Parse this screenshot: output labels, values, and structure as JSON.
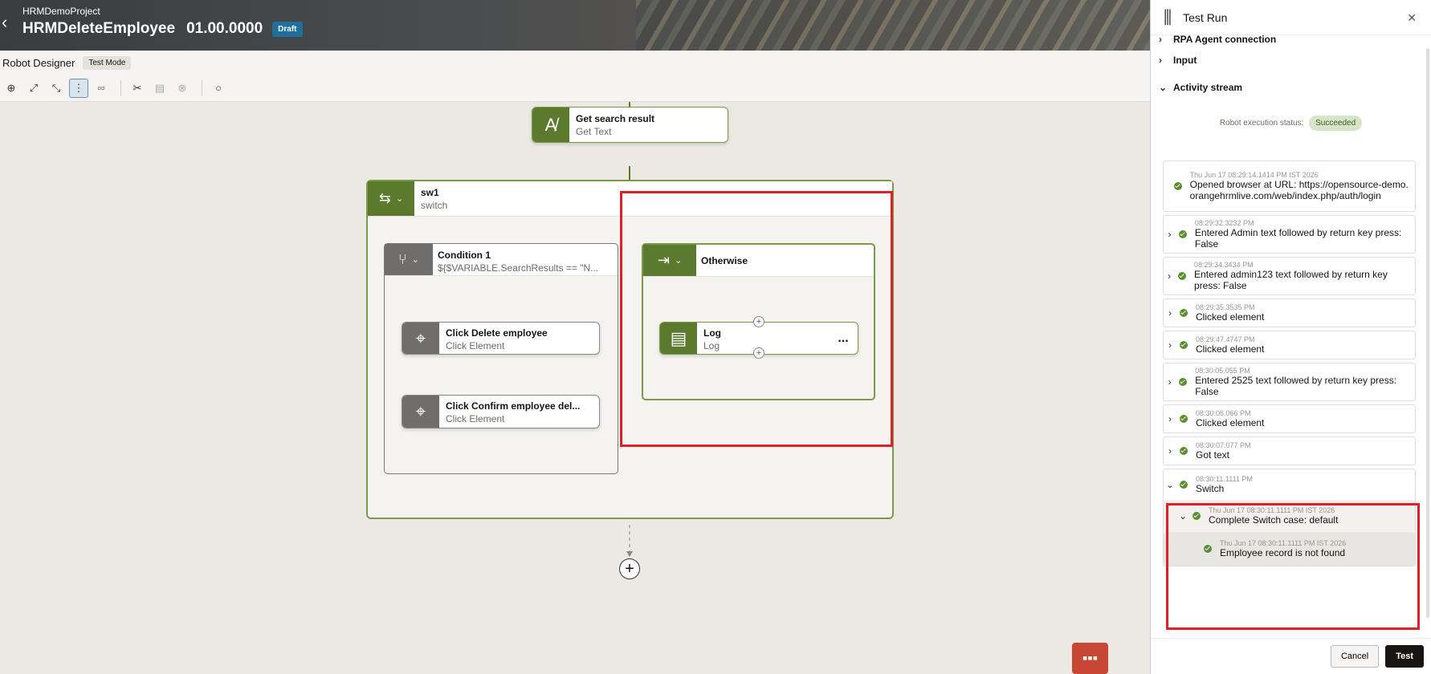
{
  "header": {
    "project": "HRMDemoProject",
    "robot_name": "HRMDeleteEmployee",
    "version": "01.00.0000",
    "status_badge": "Draft"
  },
  "subbar": {
    "title": "Robot Designer",
    "mode": "Test Mode"
  },
  "toolbar": {
    "icons": [
      "zoom-in-icon",
      "expand-icon",
      "collapse-icon",
      "vertical-layout-icon",
      "horizontal-layout-icon",
      "cut-icon",
      "paste-icon",
      "delete-icon",
      "circle-icon"
    ]
  },
  "flow": {
    "get_search": {
      "title": "Get search result",
      "subtitle": "Get Text"
    },
    "switch": {
      "title": "sw1",
      "subtitle": "switch"
    },
    "condition": {
      "title": "Condition 1",
      "subtitle": "${$VARIABLE.SearchResults == \"N..."
    },
    "click_delete": {
      "title": "Click Delete employee",
      "subtitle": "Click Element"
    },
    "click_confirm": {
      "title": "Click Confirm employee del...",
      "subtitle": "Click Element"
    },
    "otherwise": {
      "title": "Otherwise"
    },
    "log": {
      "title": "Log",
      "subtitle": "Log",
      "menu": "..."
    }
  },
  "panel": {
    "title": "Test Run",
    "sections": {
      "rpa": "RPA Agent connection",
      "input": "Input",
      "activity": "Activity stream"
    },
    "status_label": "Robot execution status:",
    "status_value": "Succeeded",
    "stream": [
      {
        "ts": "Thu Jun 17 08:29:14.1414 PM IST 2026",
        "msg": "Opened browser at URL: https://opensource-demo.orangehrmlive.com/web/index.php/auth/login",
        "expandable": false
      },
      {
        "ts": "08:29:32.3232 PM",
        "msg": "Entered Admin text followed by return key press: False",
        "expandable": true
      },
      {
        "ts": "08:29:34.3434 PM",
        "msg": "Entered admin123 text followed by return key press: False",
        "expandable": true
      },
      {
        "ts": "08:29:35.3535 PM",
        "msg": "Clicked element",
        "expandable": true
      },
      {
        "ts": "08:29:47.4747 PM",
        "msg": "Clicked element",
        "expandable": true
      },
      {
        "ts": "08:30:05.055 PM",
        "msg": "Entered 2525 text followed by return key press: False",
        "expandable": true
      },
      {
        "ts": "08:30:06.066 PM",
        "msg": "Clicked element",
        "expandable": true
      },
      {
        "ts": "08:30:07.077 PM",
        "msg": "Got text",
        "expandable": true
      },
      {
        "ts": "08:30:11.1111 PM",
        "msg": "Switch",
        "expandable": true
      }
    ],
    "switch_child": {
      "ts": "Thu Jun 17 08:30:11.1111 PM IST 2026",
      "msg": "Complete Switch case: default"
    },
    "switch_grandchild": {
      "ts": "Thu Jun 17 08:30:11.1111 PM IST 2026",
      "msg": "Employee record is not found"
    },
    "cancel": "Cancel",
    "test": "Test"
  },
  "colors": {
    "accent_green": "#5b7a2d",
    "highlight_red": "#e01f26",
    "chat": "#c74634"
  }
}
